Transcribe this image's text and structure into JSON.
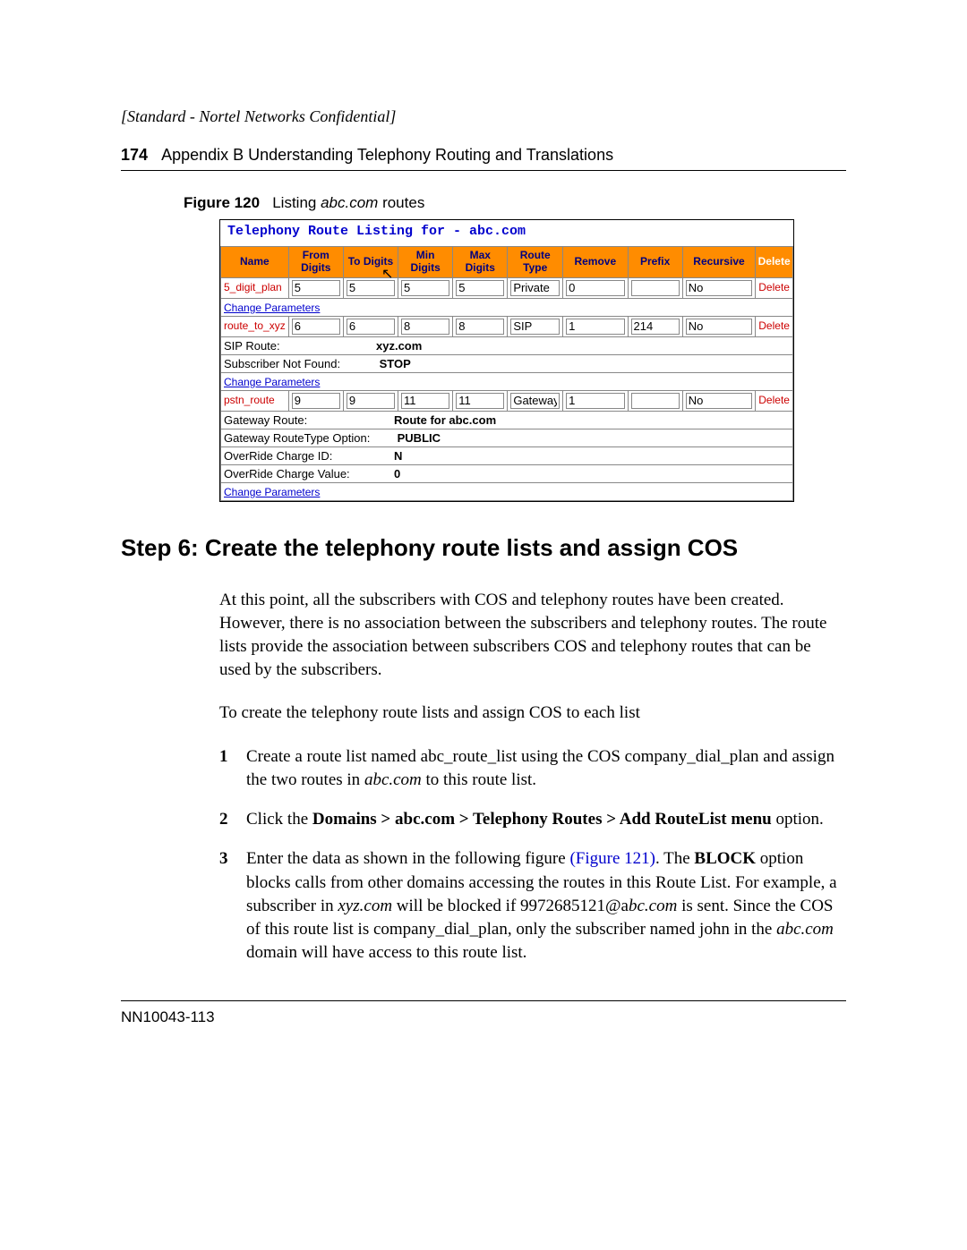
{
  "doc": {
    "confidential": "[Standard - Nortel Networks Confidential]",
    "page_number": "174",
    "section": "Appendix B  Understanding Telephony Routing and Translations",
    "figure_label": "Figure 120",
    "figure_text_pre": "Listing ",
    "figure_text_italic": "abc.com",
    "figure_text_post": " routes",
    "step_heading": "Step 6: Create the telephony route lists and assign COS",
    "para1": "At this point, all the subscribers with COS and telephony routes have been created. However, there is no association between the subscribers and telephony routes. The route lists provide the association between subscribers COS and telephony routes that can be used by the subscribers.",
    "para2": "To create the telephony route lists and assign COS to each list",
    "item1_a": "Create a route list named abc_route_list using the COS company_dial_plan and assign the two routes in ",
    "item1_i": "abc.com",
    "item1_b": " to this route list.",
    "item2_a": "Click the ",
    "item2_bold": "Domains > abc.com > Telephony Routes > Add RouteList menu",
    "item2_b": " option.",
    "item3_a": "Enter the data as shown in the following figure ",
    "item3_fig": "(Figure 121)",
    "item3_b": ". The ",
    "item3_block": "BLOCK",
    "item3_c": " option blocks calls from other domains accessing the routes in this Route List. For example, a subscriber in ",
    "item3_xyz": "xyz.com",
    "item3_d": " will be blocked if 9972685121@a",
    "item3_abc": "bc.com",
    "item3_e": " is sent. Since the COS of this route list is company_dial_plan, only the subscriber named john in the ",
    "item3_abc2": "abc.com",
    "item3_f": " domain will have access to this route list.",
    "doc_id": "NN10043-113"
  },
  "figure": {
    "title": "Telephony Route Listing for - abc.com",
    "headers": {
      "name": "Name",
      "from": "From Digits",
      "to": "To Digits",
      "min": "Min Digits",
      "max": "Max Digits",
      "rtype": "Route Type",
      "remove": "Remove",
      "prefix": "Prefix",
      "recursive": "Recursive",
      "delete": "Delete"
    },
    "rows": [
      {
        "name": "5_digit_plan",
        "from": "5",
        "to": "5",
        "min": "5",
        "max": "5",
        "rtype": "Private",
        "remove": "0",
        "prefix": "",
        "recursive": "No"
      },
      {
        "name": "route_to_xyz",
        "from": "6",
        "to": "6",
        "min": "8",
        "max": "8",
        "rtype": "SIP",
        "remove": "1",
        "prefix": "214",
        "recursive": "No"
      },
      {
        "name": "pstn_route",
        "from": "9",
        "to": "9",
        "min": "11",
        "max": "11",
        "rtype": "Gateway",
        "remove": "1",
        "prefix": "",
        "recursive": "No"
      }
    ],
    "sip_details": {
      "route_lbl": "SIP Route:",
      "route_val": "xyz.com",
      "notfound_lbl": "Subscriber Not Found:",
      "notfound_val": "STOP"
    },
    "gw_details": {
      "route_lbl": "Gateway Route:",
      "route_val": "Route for abc.com",
      "type_lbl": "Gateway RouteType Option:",
      "type_val": "PUBLIC",
      "chargeid_lbl": "OverRide Charge ID:",
      "chargeid_val": "N",
      "chargeval_lbl": "OverRide Charge Value:",
      "chargeval_val": "0"
    },
    "change_params": "Change Parameters",
    "delete_label": "Delete"
  }
}
